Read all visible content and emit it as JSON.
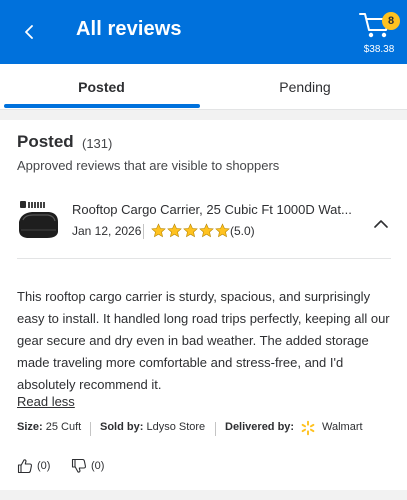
{
  "header": {
    "title": "All reviews",
    "cart_count": "8",
    "cart_total": "$38.38",
    "colors": {
      "background": "#0071dc",
      "badge": "#ffc220"
    }
  },
  "tabs": [
    {
      "label": "Posted",
      "selected": true
    },
    {
      "label": "Pending",
      "selected": false
    }
  ],
  "section": {
    "title": "Posted",
    "count": "(131)",
    "subtitle": "Approved reviews that are visible to shoppers"
  },
  "review": {
    "product_name": "Rooftop Cargo Carrier, 25 Cubic Ft 1000D Wat...",
    "date": "Jan 12, 2026",
    "rating": 5,
    "rating_text": "(5.0)",
    "body": "This rooftop cargo carrier is sturdy, spacious, and surprisingly easy to install. It handled long road trips perfectly, keeping all our gear secure and dry even in bad weather. The added storage made traveling more comfortable and stress-free, and I'd absolutely recommend it.",
    "read_less": "Read less",
    "size_label": "Size:",
    "size_value": "25 Cuft",
    "sold_by_label": "Sold by:",
    "sold_by_value": "Ldyso Store",
    "delivered_by_label": "Delivered by:",
    "delivered_by_value": "Walmart",
    "helpful_count": "(0)",
    "not_helpful_count": "(0)",
    "star_color": "#ffc220"
  }
}
